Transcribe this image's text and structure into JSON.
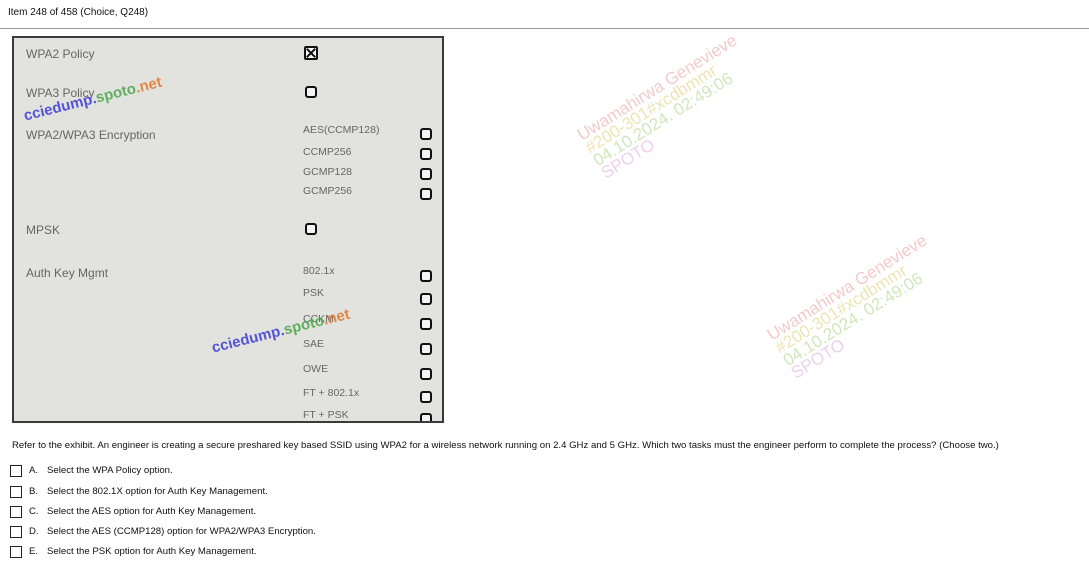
{
  "header": {
    "item_text": "Item 248 of 458  (Choice, Q248)"
  },
  "exhibit": {
    "labels": {
      "wpa2_policy": "WPA2 Policy",
      "wpa3_policy": "WPA3 Policy",
      "encryption": "WPA2/WPA3 Encryption",
      "mpsk": "MPSK",
      "akm": "Auth Key Mgmt"
    },
    "encryption_options": [
      "AES(CCMP128)",
      "CCMP256",
      "GCMP128",
      "GCMP256"
    ],
    "akm_options": [
      "802.1x",
      "PSK",
      "CCKM",
      "SAE",
      "OWE",
      "FT + 802.1x",
      "FT + PSK"
    ]
  },
  "question": {
    "text": "Refer to the exhibit. An engineer is creating a secure preshared key based SSID using WPA2 for a wireless network running on 2.4 GHz and 5 GHz. Which two tasks must the engineer perform to complete the process? (Choose two.)"
  },
  "answers": [
    {
      "letter": "A.",
      "text": "Select the WPA Policy option."
    },
    {
      "letter": "B.",
      "text": "Select the 802.1X option for Auth Key Management."
    },
    {
      "letter": "C.",
      "text": "Select the AES option for Auth Key Management."
    },
    {
      "letter": "D.",
      "text": "Select the AES (CCMP128) option for WPA2/WPA3 Encryption."
    },
    {
      "letter": "E.",
      "text": "Select the PSK option for Auth Key Management."
    }
  ],
  "watermark": {
    "line1": "Uwamahirwa Genevieve",
    "line2": "#200-301#xcdbmmr",
    "line3": "04.10.2024. 02:49:06",
    "line4": "SPOTO",
    "site_a": "cciedump.",
    "site_b": "spoto",
    "site_c": ".net"
  }
}
